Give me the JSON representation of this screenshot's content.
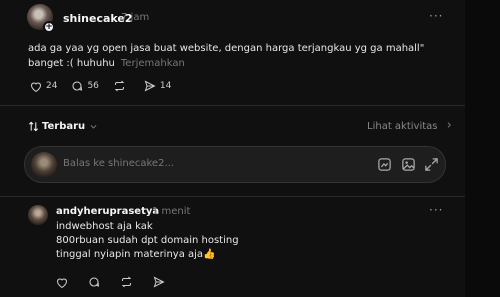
{
  "post": {
    "username": "shinecake2",
    "time": "7 jam",
    "more_label": "···",
    "text": "ada ga yaa yg open jasa buat website, dengan harga terjangkau yg ga mahall\" banget :( huhuhu",
    "translate_label": "Terjemahkan",
    "like_count": "24",
    "comment_count": "56",
    "share_count": "14"
  },
  "sort_bar": {
    "label": "Terbaru",
    "activity_label": "Lihat aktivitas"
  },
  "reply_box": {
    "placeholder": "Balas ke shinecake2..."
  },
  "comment": {
    "username": "andyheruprasetya",
    "time": "1 menit",
    "more_label": "···",
    "lines": [
      "indwebhost aja kak",
      "800rbuan sudah dpt domain hosting",
      "tinggal nyiapin materinya aja👍"
    ]
  },
  "icons": {
    "like": "heart-icon",
    "comment": "comment-icon",
    "repost": "repost-icon",
    "share": "send-icon",
    "sort": "sort-arrows-icon",
    "chevron": "chevron-right-icon",
    "gif": "gif-icon",
    "image": "image-icon",
    "expand": "expand-icon"
  },
  "colors": {
    "background": "#101010",
    "text": "#f3f5f7",
    "muted": "#777777",
    "input_bg": "#1e1e1e"
  }
}
